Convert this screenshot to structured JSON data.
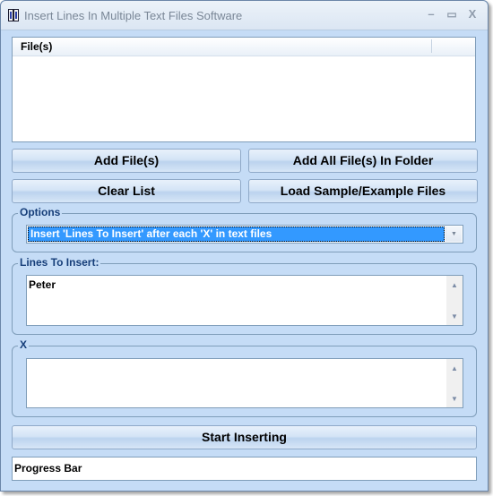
{
  "window": {
    "title": "Insert Lines In Multiple Text Files Software",
    "app_icon": "text-files-icon",
    "controls": {
      "minimize": "–",
      "maximize": "▭",
      "close": "X"
    }
  },
  "file_list": {
    "columns": [
      "File(s)"
    ],
    "rows": []
  },
  "buttons": {
    "add_files": "Add File(s)",
    "add_folder": "Add All File(s) In Folder",
    "clear_list": "Clear List",
    "load_sample": "Load Sample/Example Files",
    "start": "Start Inserting"
  },
  "options": {
    "label": "Options",
    "selected": "Insert 'Lines To Insert' after each 'X' in text files",
    "arrow": "▼"
  },
  "lines_to_insert": {
    "label": "Lines To Insert:",
    "value": "Peter"
  },
  "x_group": {
    "label": "X",
    "value": ""
  },
  "scroll": {
    "up": "▲",
    "down": "▼"
  },
  "progress": {
    "label": "Progress Bar"
  },
  "colors": {
    "window_bg": "#c5dcf6",
    "group_label": "#163e79",
    "selection": "#3399ff"
  }
}
